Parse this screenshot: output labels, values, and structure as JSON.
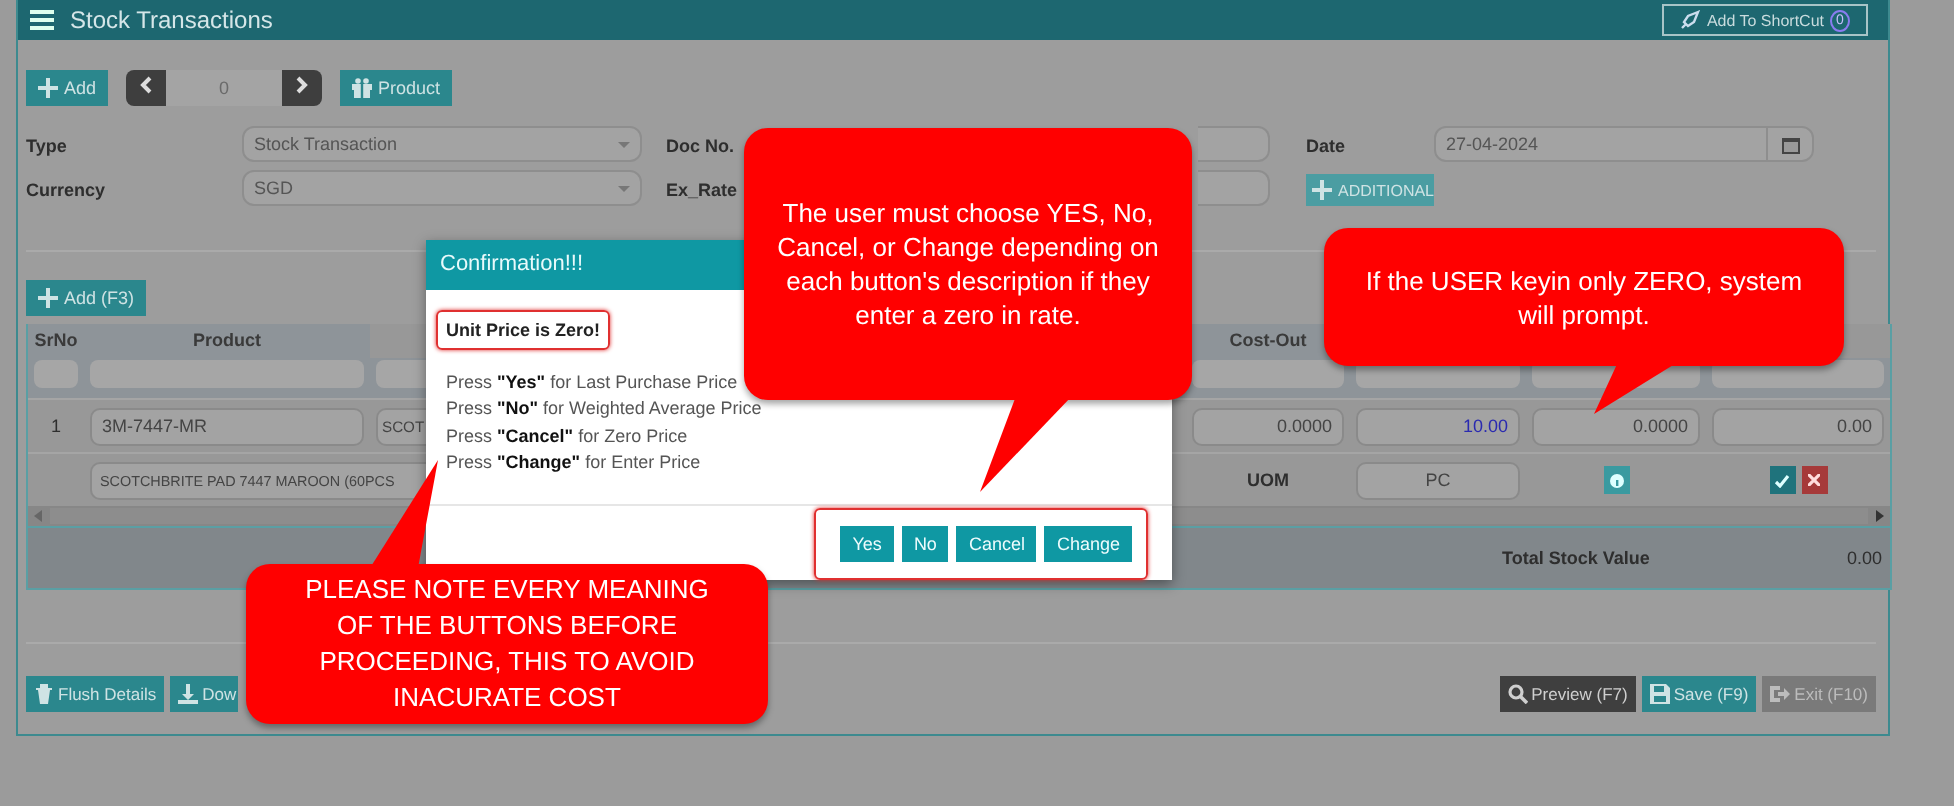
{
  "header": {
    "title": "Stock Transactions",
    "shortcut": "Add To ShortCut",
    "shortcut_count": "0"
  },
  "toolbar": {
    "add": "Add",
    "record": "0",
    "product": "Product"
  },
  "form": {
    "fields": [
      {
        "label": "Type",
        "value": "Stock Transaction",
        "kind": "select"
      },
      {
        "label": "Doc No.",
        "kind": "text"
      },
      {
        "label": "Date",
        "value": "27-04-2024",
        "kind": "date"
      },
      {
        "label": "Currency",
        "value": "SGD",
        "kind": "select"
      },
      {
        "label": "Ex_Rate",
        "kind": "text"
      }
    ],
    "additional": "ADDITIONAL"
  },
  "details": {
    "add": "Add (F3)",
    "headers": {
      "srno": "SrNo",
      "product": "Product",
      "cost_out": "Cost-Out"
    },
    "row": {
      "srno": "1",
      "product_code": "3M-7447-MR",
      "column_3": "SCOT",
      "cost_out": "0.0000",
      "column_5": "10.00",
      "column_6": "0.0000",
      "column_7": "0.00",
      "description": "SCOTCHBRITE PAD 7447 MAROON (60PCS",
      "uom_label": "UOM",
      "uom": "PC"
    },
    "total": {
      "label": "Total Stock Value",
      "value": "0.00"
    }
  },
  "footer": {
    "left": [
      {
        "label": "Flush Details",
        "kind": "flush"
      },
      {
        "label": "Dow",
        "kind": "download"
      }
    ],
    "right": [
      {
        "label": "Preview (F7)",
        "kind": "preview"
      },
      {
        "label": "Save (F9)",
        "kind": "save"
      },
      {
        "label": "Exit (F10)",
        "kind": "exit"
      }
    ]
  },
  "dialog": {
    "title": "Confirmation!!!",
    "heading": "Unit Price is Zero!",
    "lines": [
      "Press **\"Yes\"** for Last Purchase Price",
      "Press **\"No\"** for Weighted Average Price",
      "Press **\"Cancel\"** for Zero Price",
      "Press **\"Change\"** for Enter Price"
    ],
    "buttons": [
      "Yes",
      "No",
      "Cancel",
      "Change"
    ]
  },
  "callouts": [
    {
      "text": "The user must choose YES, No, Cancel, or Change depending on each button's description if they enter a zero in rate."
    },
    {
      "text": "If the USER keyin only ZERO, system will prompt."
    },
    {
      "text": "PLEASE NOTE EVERY MEANING OF THE BUTTONS BEFORE PROCEEDING, THIS TO AVOID INACURATE COST"
    }
  ]
}
